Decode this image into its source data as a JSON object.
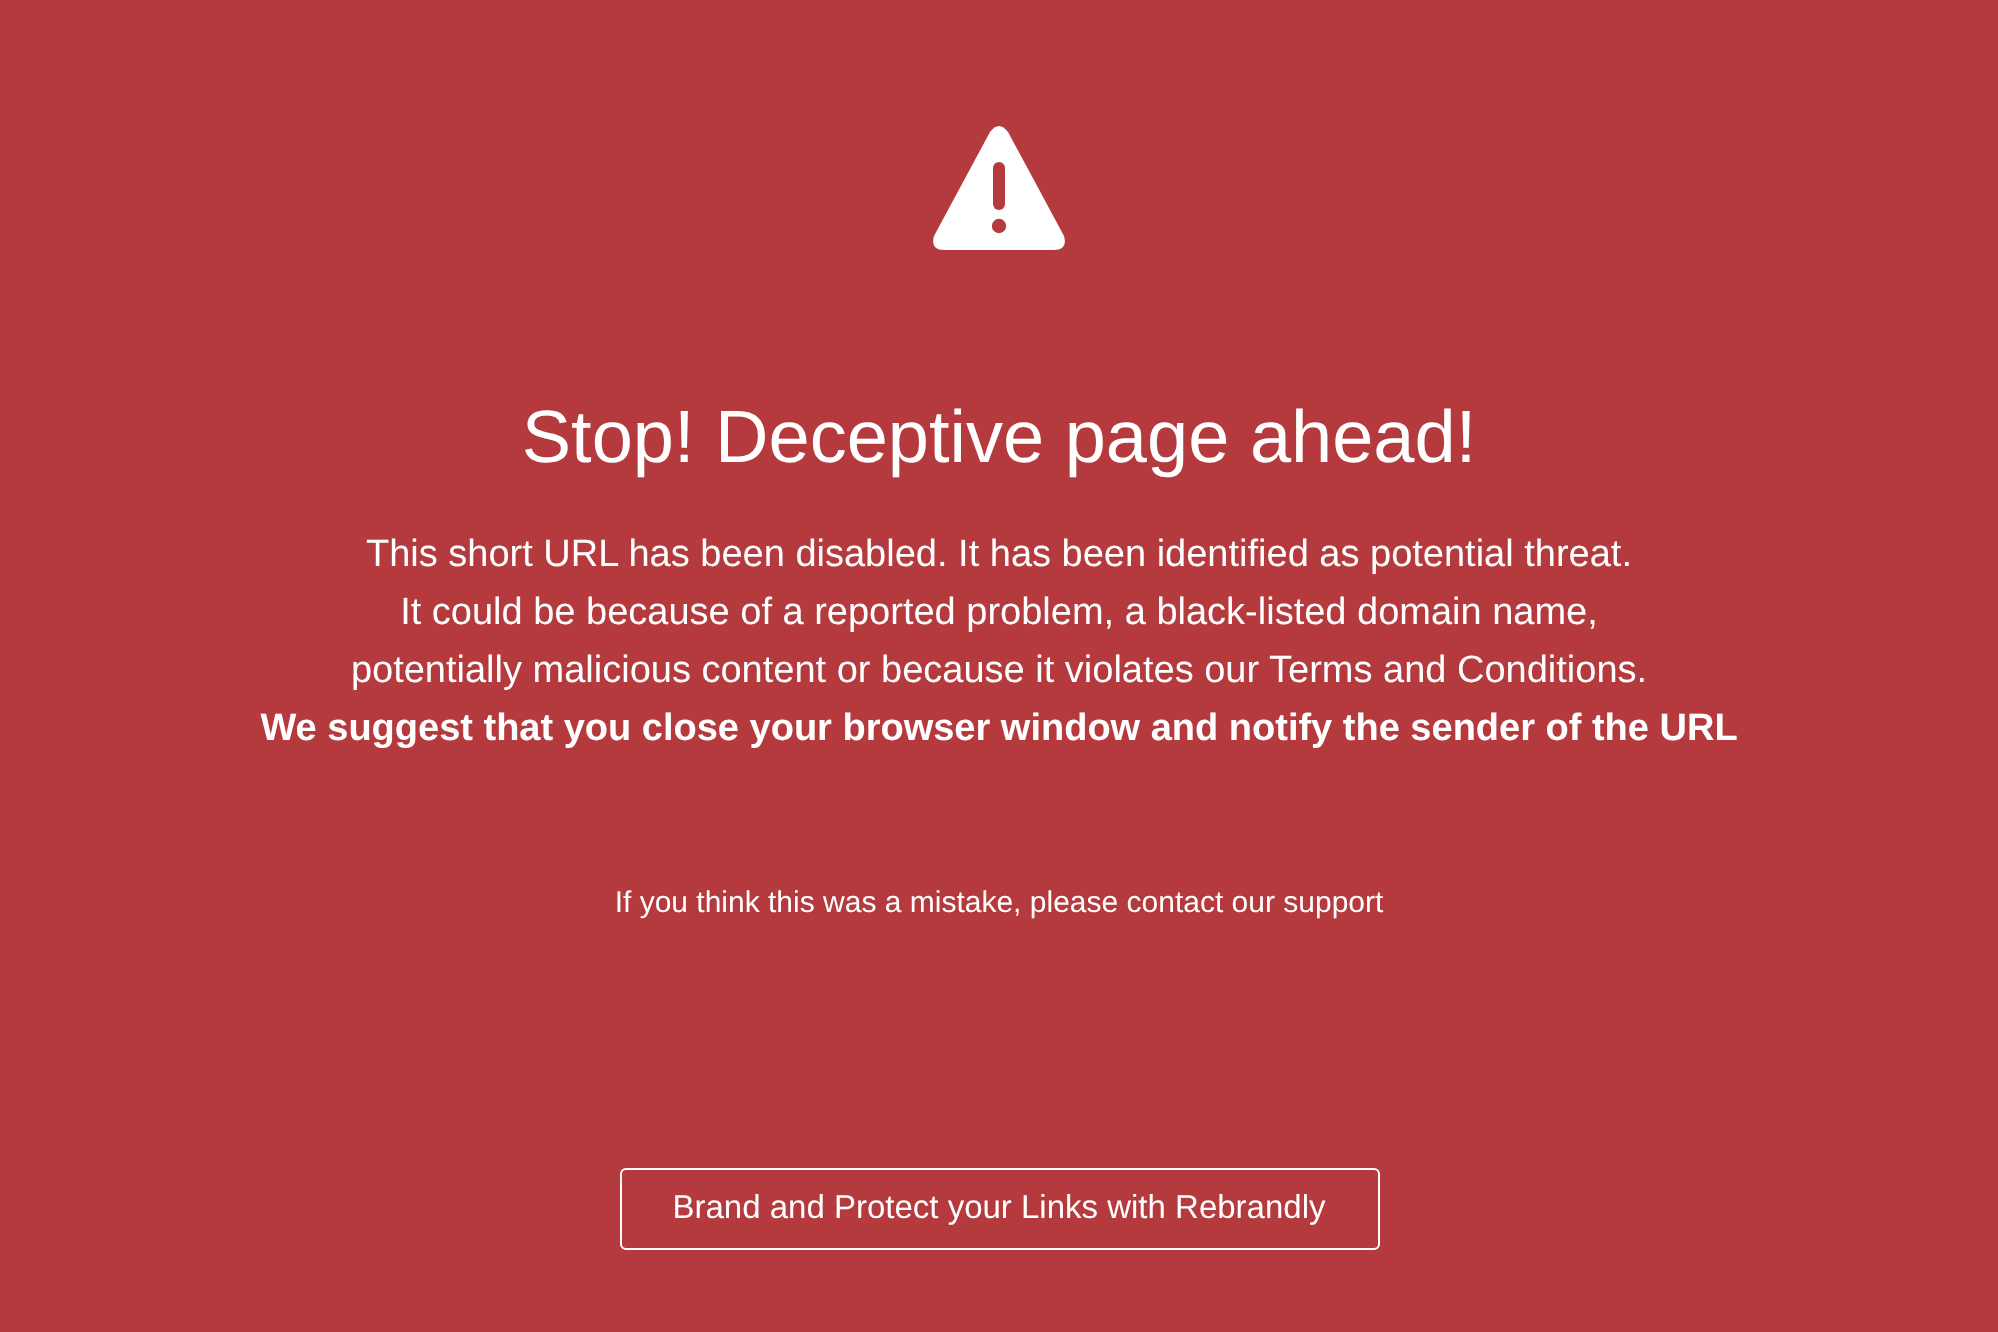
{
  "title": "Stop! Deceptive page ahead!",
  "message_lines": [
    "This short URL has been disabled. It has been identified as potential threat.",
    "It could be because of a reported problem, a black-listed domain name,",
    "potentially malicious content or because it violates our Terms and Conditions."
  ],
  "advice": "We suggest that you close your browser window and notify the sender of the URL",
  "support_note": "If you think this was a mistake, please contact our support",
  "button": {
    "label": "Brand and Protect your Links with Rebrandly"
  }
}
